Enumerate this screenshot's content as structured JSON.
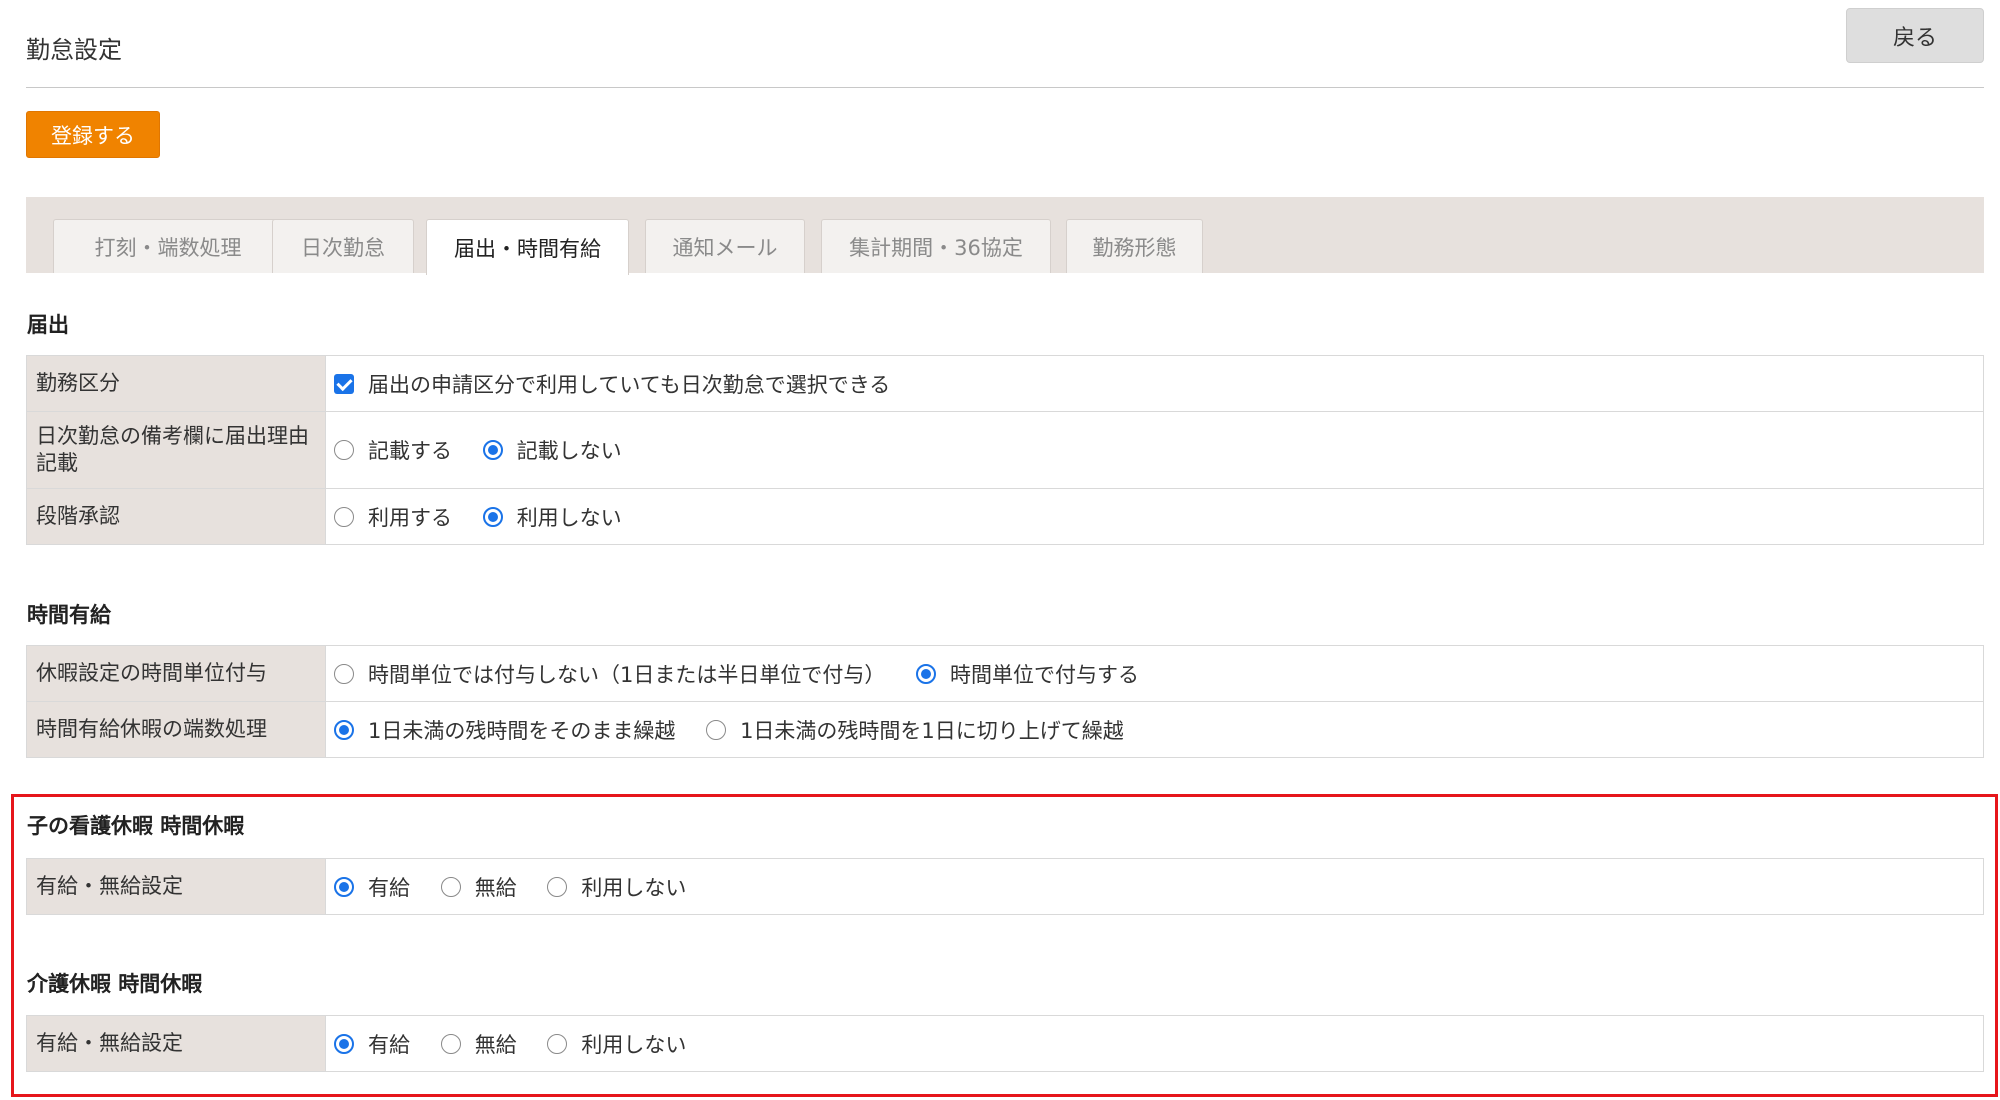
{
  "header": {
    "title": "勤怠設定",
    "back_label": "戻る"
  },
  "actions": {
    "register_label": "登録する"
  },
  "tabs": [
    {
      "label": "打刻・端数処理",
      "active": false
    },
    {
      "label": "日次勤怠",
      "active": false
    },
    {
      "label": "届出・時間有給",
      "active": true
    },
    {
      "label": "通知メール",
      "active": false
    },
    {
      "label": "集計期間・36協定",
      "active": false
    },
    {
      "label": "勤務形態",
      "active": false
    }
  ],
  "sections": {
    "notification": {
      "heading": "届出",
      "rows": [
        {
          "label": "勤務区分",
          "options": [
            {
              "type": "checkbox",
              "text": "届出の申請区分で利用していても日次勤怠で選択できる",
              "checked": true
            }
          ]
        },
        {
          "label": "日次勤怠の備考欄に届出理由記載",
          "options": [
            {
              "type": "radio",
              "text": "記載する",
              "checked": false
            },
            {
              "type": "radio",
              "text": "記載しない",
              "checked": true
            }
          ]
        },
        {
          "label": "段階承認",
          "options": [
            {
              "type": "radio",
              "text": "利用する",
              "checked": false
            },
            {
              "type": "radio",
              "text": "利用しない",
              "checked": true
            }
          ]
        }
      ]
    },
    "hourly_leave": {
      "heading": "時間有給",
      "rows": [
        {
          "label": "休暇設定の時間単位付与",
          "options": [
            {
              "type": "radio",
              "text": "時間単位では付与しない（1日または半日単位で付与）",
              "checked": false
            },
            {
              "type": "radio",
              "text": "時間単位で付与する",
              "checked": true
            }
          ]
        },
        {
          "label": "時間有給休暇の端数処理",
          "options": [
            {
              "type": "radio",
              "text": "1日未満の残時間をそのまま繰越",
              "checked": true
            },
            {
              "type": "radio",
              "text": "1日未満の残時間を1日に切り上げて繰越",
              "checked": false
            }
          ]
        }
      ]
    },
    "child_care": {
      "heading": "子の看護休暇 時間休暇",
      "rows": [
        {
          "label": "有給・無給設定",
          "options": [
            {
              "type": "radio",
              "text": "有給",
              "checked": true
            },
            {
              "type": "radio",
              "text": "無給",
              "checked": false
            },
            {
              "type": "radio",
              "text": "利用しない",
              "checked": false
            }
          ]
        }
      ]
    },
    "nursing_care": {
      "heading": "介護休暇 時間休暇",
      "rows": [
        {
          "label": "有給・無給設定",
          "options": [
            {
              "type": "radio",
              "text": "有給",
              "checked": true
            },
            {
              "type": "radio",
              "text": "無給",
              "checked": false
            },
            {
              "type": "radio",
              "text": "利用しない",
              "checked": false
            }
          ]
        }
      ]
    }
  },
  "colors": {
    "accent": "#f08300",
    "highlight": "#e6161b",
    "label_bg": "#e7e1dd",
    "control": "#1a73e8"
  }
}
